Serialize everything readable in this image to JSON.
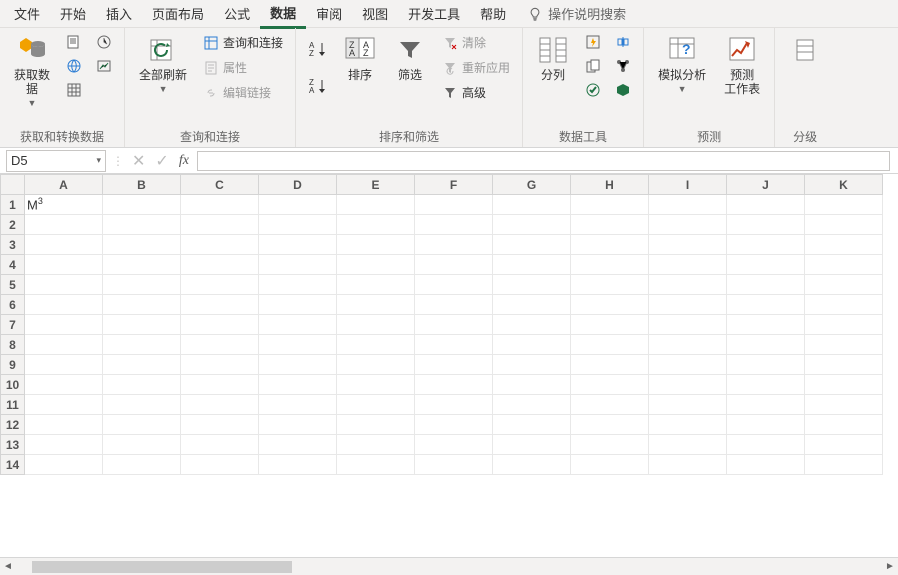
{
  "tabs": {
    "file": "文件",
    "home": "开始",
    "insert": "插入",
    "layout": "页面布局",
    "formula": "公式",
    "data": "数据",
    "review": "审阅",
    "view": "视图",
    "dev": "开发工具",
    "help": "帮助",
    "tellme": "操作说明搜索"
  },
  "ribbon": {
    "get_data": "获取数\n据",
    "group_get": "获取和转换数据",
    "refresh": "全部刷新",
    "queries": "查询和连接",
    "props": "属性",
    "edit_links": "编辑链接",
    "group_query": "查询和连接",
    "sort": "排序",
    "filter": "筛选",
    "clear": "清除",
    "reapply": "重新应用",
    "advanced": "高级",
    "group_sort": "排序和筛选",
    "text_to_col": "分列",
    "group_tools": "数据工具",
    "whatif": "模拟分析",
    "forecast": "预测\n工作表",
    "group_forecast": "预测",
    "group_outline": "分级"
  },
  "namebox": "D5",
  "columns": [
    "A",
    "B",
    "C",
    "D",
    "E",
    "F",
    "G",
    "H",
    "I",
    "J",
    "K"
  ],
  "rows": [
    "1",
    "2",
    "3",
    "4",
    "5",
    "6",
    "7",
    "8",
    "9",
    "10",
    "11",
    "12",
    "13",
    "14"
  ],
  "cell_A1_base": "M",
  "cell_A1_sup": "3"
}
